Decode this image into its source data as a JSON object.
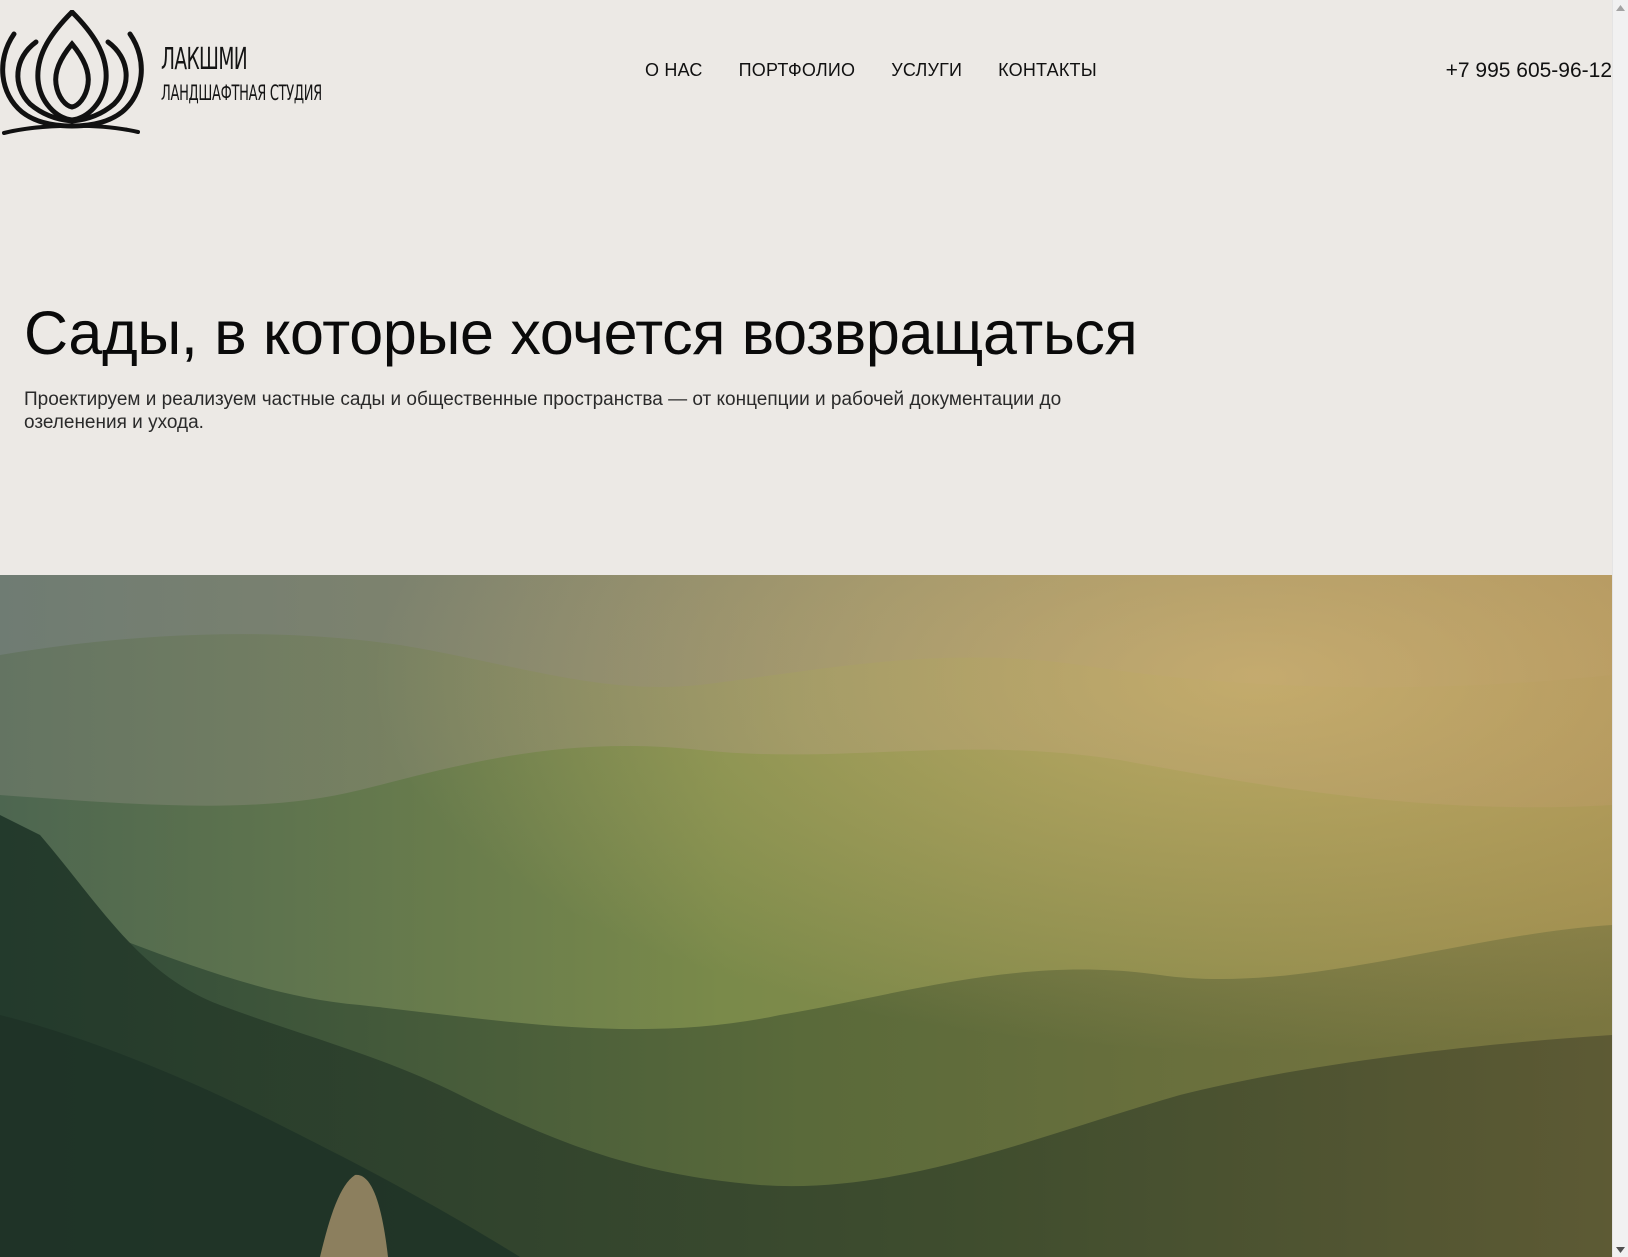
{
  "header": {
    "logo": {
      "title": "ЛАКШМИ",
      "subtitle": "ЛАНДШАФТНАЯ СТУДИЯ",
      "icon": "lotus-icon"
    },
    "nav": [
      {
        "label": "О НАС"
      },
      {
        "label": "ПОРТФОЛИО"
      },
      {
        "label": "УСЛУГИ"
      },
      {
        "label": "КОНТАКТЫ"
      }
    ],
    "phone": "+7 995 605-96-12"
  },
  "hero": {
    "title": "Сады, в которые хочется возвращаться",
    "lead": "Проектируем и реализуем частные сады и общественные пространства — от концепции и рабочей документации до озеленения и ухода."
  },
  "photo": {
    "subject": "mountain-landscape-image"
  },
  "colors": {
    "background": "#ece9e5",
    "text": "#111111"
  },
  "scrollbar": {
    "up_icon": "arrow-up-icon",
    "down_icon": "arrow-down-icon"
  }
}
